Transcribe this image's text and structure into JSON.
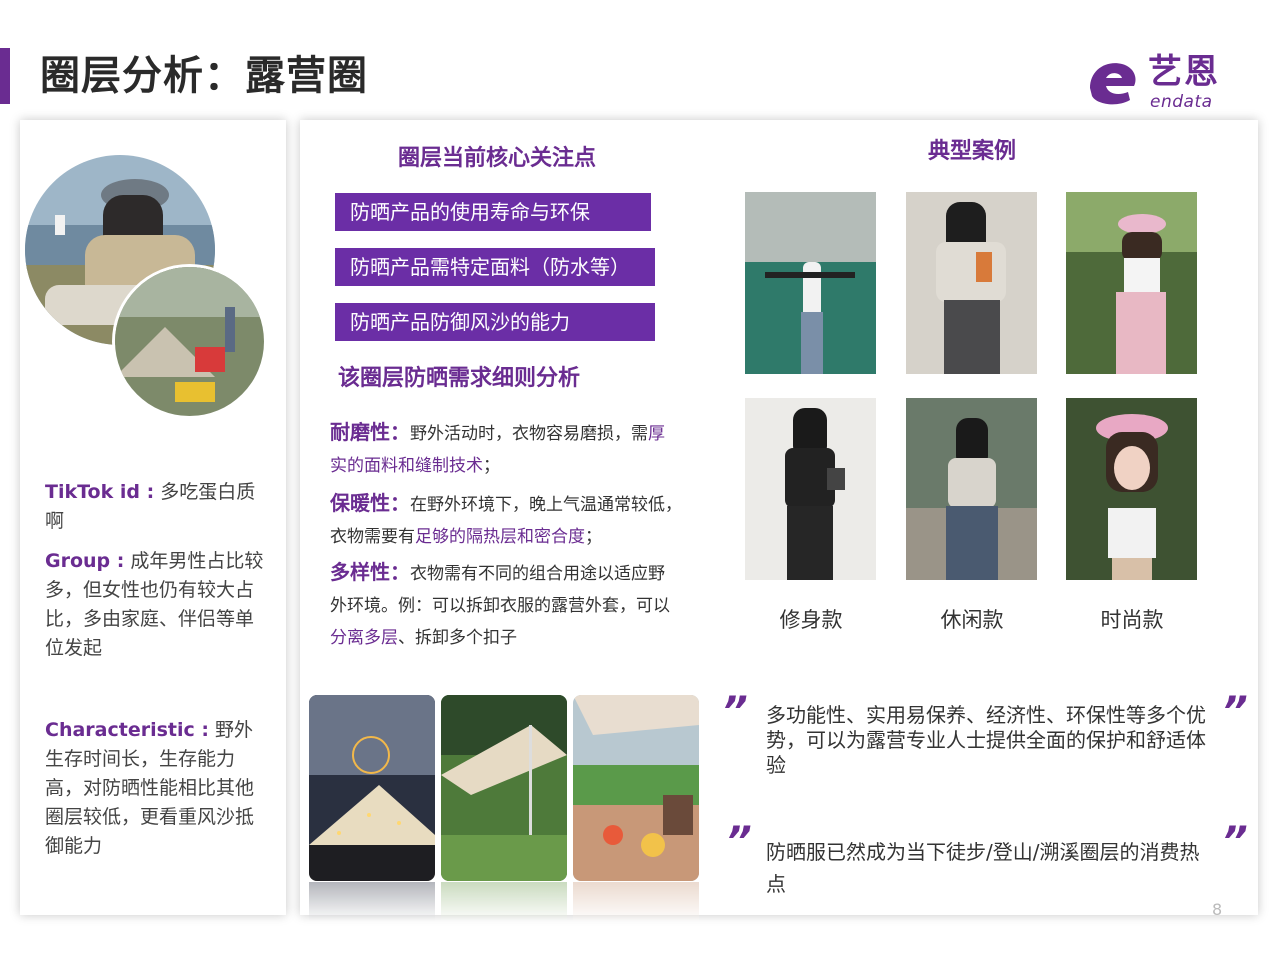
{
  "page": {
    "title": "圈层分析：露营圈",
    "page_number": "8"
  },
  "logo": {
    "cn": "艺恩",
    "en": "endata",
    "color": "#6a2c91"
  },
  "profile": {
    "tiktok_key": "TikTok id :",
    "tiktok_value": "多吃蛋白质啊",
    "group_key": "Group :",
    "group_value": "成年男性占比较多，但女性也仍有较大占比，多由家庭、伴侣等单位发起",
    "char_key": "Characteristic :",
    "char_value": "野外生存时间长，生存能力高，对防晒性能相比其他圈层较低，更看重风沙抵御能力"
  },
  "focus": {
    "title": "圈层当前核心关注点",
    "items": [
      "防晒产品的使用寿命与环保",
      "防晒产品需特定面料（防水等）",
      "防晒产品防御风沙的能力"
    ]
  },
  "analysis": {
    "title": "该圈层防晒需求细则分析",
    "wear": {
      "head": "耐磨性：",
      "l1": "野外活动时，衣物容易磨损，需",
      "l1_hl": "厚",
      "l2_hl": "实的面料和缝制技术",
      "l2": "；"
    },
    "warm": {
      "head": "保暖性：",
      "l1": "在野外环境下，晚上气温通常较低，",
      "l2": "衣物需要有",
      "l2_hl": "足够的隔热层和密合度",
      "l2_end": "；"
    },
    "multi": {
      "head": "多样性：",
      "l1": "衣物需有不同的组合用途以适应野",
      "l2": "外环境。例：可以拆卸衣服的露营外套，可以",
      "l3_hl": "分离多层",
      "l3": "、拆卸多个扣子"
    }
  },
  "cases": {
    "title": "典型案例",
    "labels": [
      "修身款",
      "休闲款",
      "时尚款"
    ]
  },
  "quotes": {
    "mark": "”",
    "q1": "多功能性、实用易保养、经济性、环保性等多个优势，可以为露营专业人士提供全面的保护和舒适体验",
    "q2": "防晒服已然成为当下徒步/登山/溯溪圈层的消费热点"
  }
}
